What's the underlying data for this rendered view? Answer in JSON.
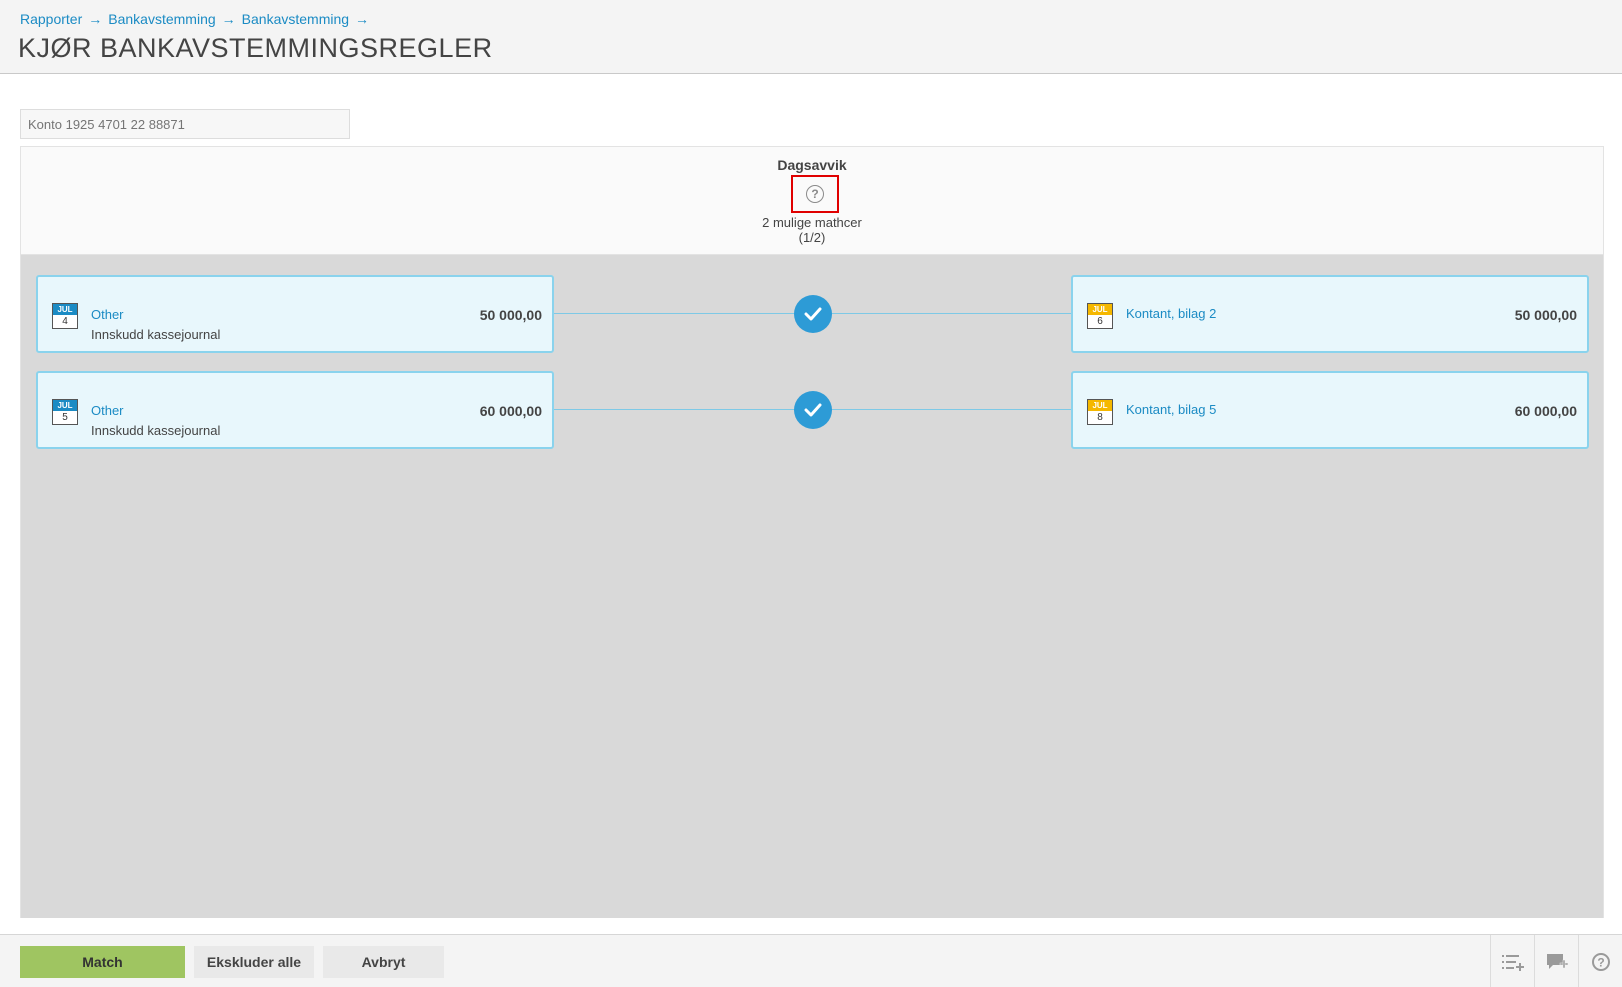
{
  "breadcrumb": {
    "items": [
      "Rapporter",
      "Bankavstemming",
      "Bankavstemming"
    ],
    "separator": "→"
  },
  "page": {
    "title": "KJØR BANKAVSTEMMINGSREGLER"
  },
  "account": {
    "placeholder": "Konto 1925 4701 22 88871"
  },
  "rule": {
    "title": "Dagsavvik",
    "help_icon": "question-circle-icon",
    "match_count": "2 mulige mathcer",
    "match_index": "(1/2)"
  },
  "matches": [
    {
      "left": {
        "month": "JUL",
        "day": "4",
        "title": "Other",
        "subtitle": "Innskudd kassejournal",
        "amount": "50 000,00"
      },
      "right": {
        "month": "JUL",
        "day": "6",
        "title": "Kontant, bilag 2",
        "amount": "50 000,00"
      }
    },
    {
      "left": {
        "month": "JUL",
        "day": "5",
        "title": "Other",
        "subtitle": "Innskudd kassejournal",
        "amount": "60 000,00"
      },
      "right": {
        "month": "JUL",
        "day": "8",
        "title": "Kontant, bilag 5",
        "amount": "60 000,00"
      }
    }
  ],
  "footer": {
    "match_label": "Match",
    "exclude_label": "Ekskluder alle",
    "cancel_label": "Avbryt",
    "icons": [
      "list-add-icon",
      "comment-add-icon",
      "help-icon"
    ]
  },
  "colors": {
    "accent": "#1b8bc4",
    "match_button": "#9fc561",
    "check": "#2d9bd6",
    "bank_calendar": "#1b8bc4",
    "ledger_calendar": "#f5b800",
    "highlight": "#e00000"
  }
}
